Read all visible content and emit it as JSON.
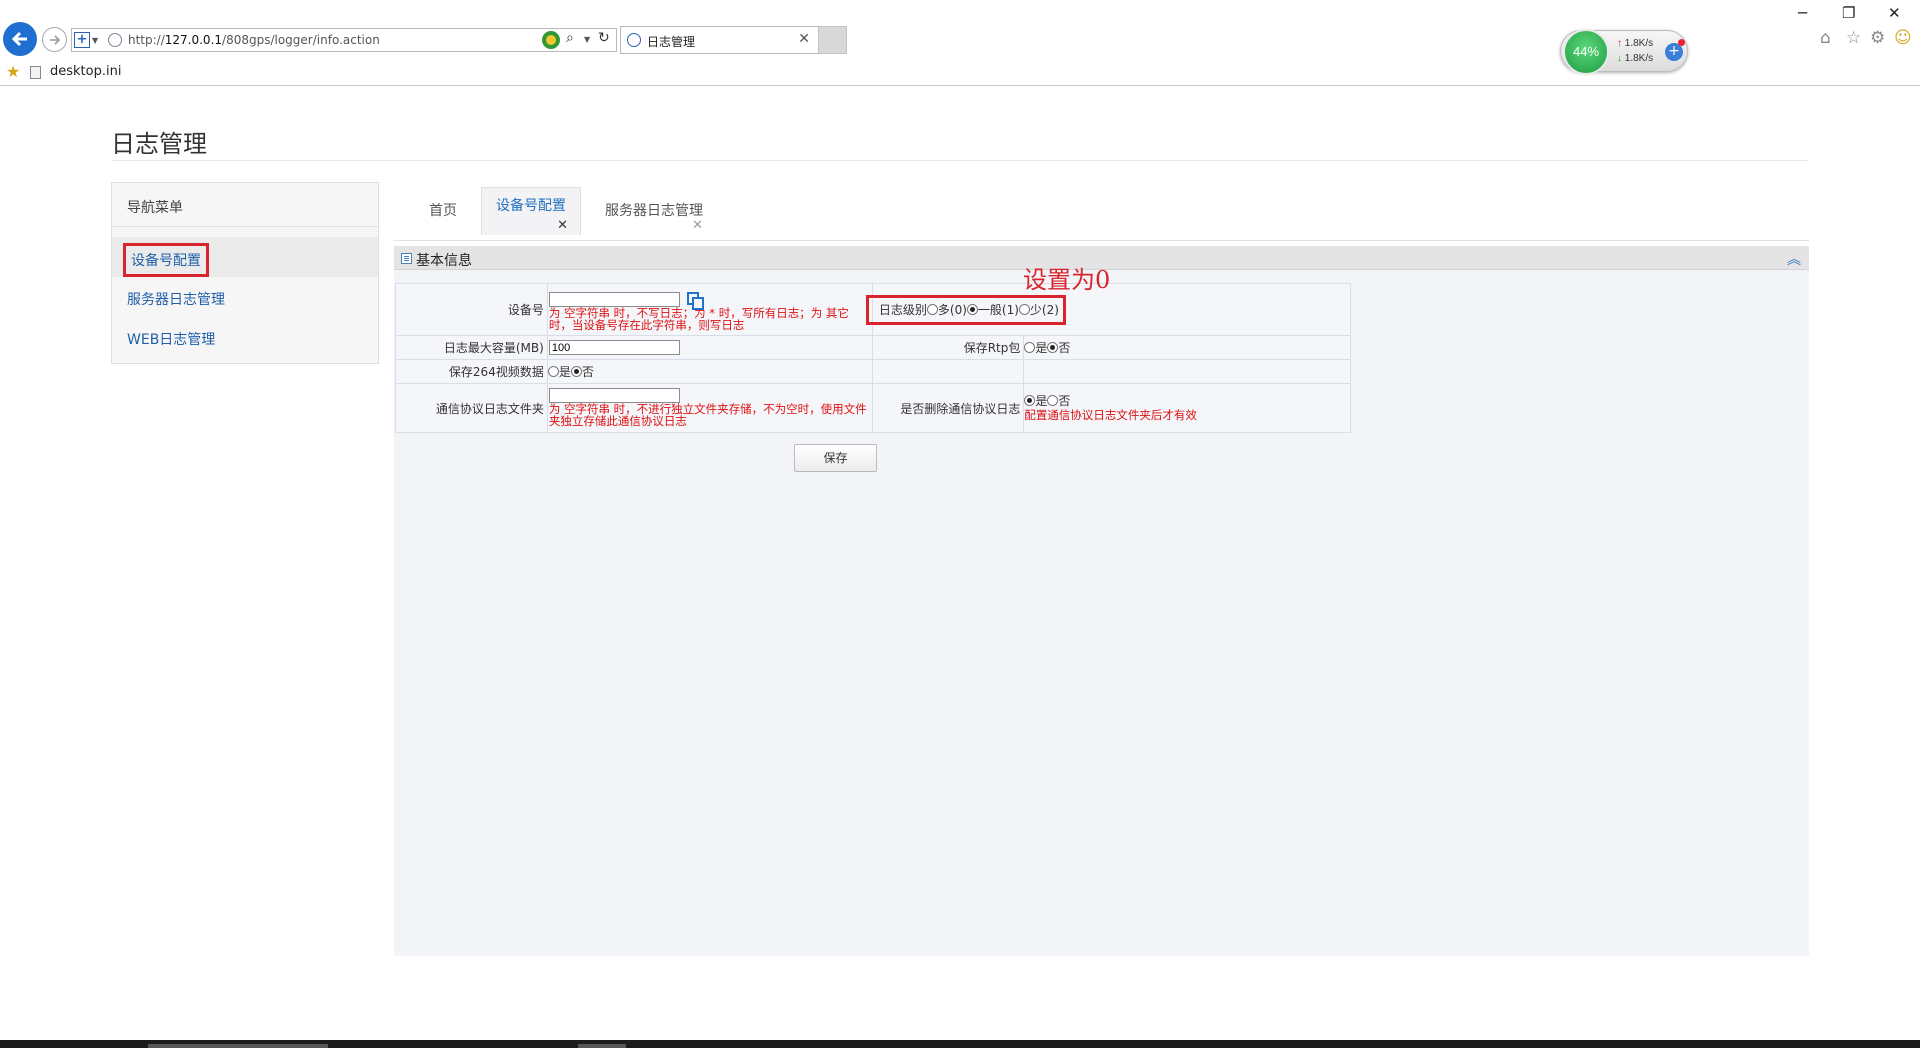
{
  "browser": {
    "url_prefix": "http://",
    "url_host": "127.0.0.1",
    "url_path": "/808gps/logger/info.action",
    "tab_title": "日志管理",
    "favorites": [
      "desktop.ini"
    ]
  },
  "speed_widget": {
    "percent": "44%",
    "up": "1.8K/s",
    "down": "1.8K/s"
  },
  "page": {
    "title": "日志管理"
  },
  "sidebar": {
    "header": "导航菜单",
    "items": [
      {
        "label": "设备号配置",
        "active": true
      },
      {
        "label": "服务器日志管理"
      },
      {
        "label": "WEB日志管理"
      }
    ]
  },
  "tabs": [
    {
      "label": "首页"
    },
    {
      "label": "设备号配置",
      "active": true
    },
    {
      "label": "服务器日志管理"
    }
  ],
  "panel": {
    "title": "基本信息",
    "annotation": "设置为0",
    "device_id": {
      "label": "设备号",
      "value": "",
      "hint": "为 空字符串 时，不写日志；为 * 时，写所有日志；为 其它时，当设备号存在此字符串，则写日志"
    },
    "log_level": {
      "label": "日志级别",
      "options": [
        "多(0)",
        "一般(1)",
        "少(2)"
      ],
      "selected": "一般(1)"
    },
    "max_size": {
      "label": "日志最大容量(MB)",
      "value": "100"
    },
    "save_rtp": {
      "label": "保存Rtp包",
      "options": [
        "是",
        "否"
      ],
      "selected": "否"
    },
    "save_264": {
      "label": "保存264视频数据",
      "options": [
        "是",
        "否"
      ],
      "selected": "否"
    },
    "proto_folder": {
      "label": "通信协议日志文件夹",
      "value": "",
      "hint": "为 空字符串 时，不进行独立文件夹存储，不为空时，使用文件夹独立存储此通信协议日志"
    },
    "delete_proto": {
      "label": "是否删除通信协议日志",
      "options": [
        "是",
        "否"
      ],
      "selected": "是",
      "hint": "配置通信协议日志文件夹后才有效"
    },
    "save_button": "保存"
  },
  "colors": {
    "accent_red": "#d9232d",
    "link_blue": "#1f5fa8",
    "hint_red": "#dd1111"
  }
}
